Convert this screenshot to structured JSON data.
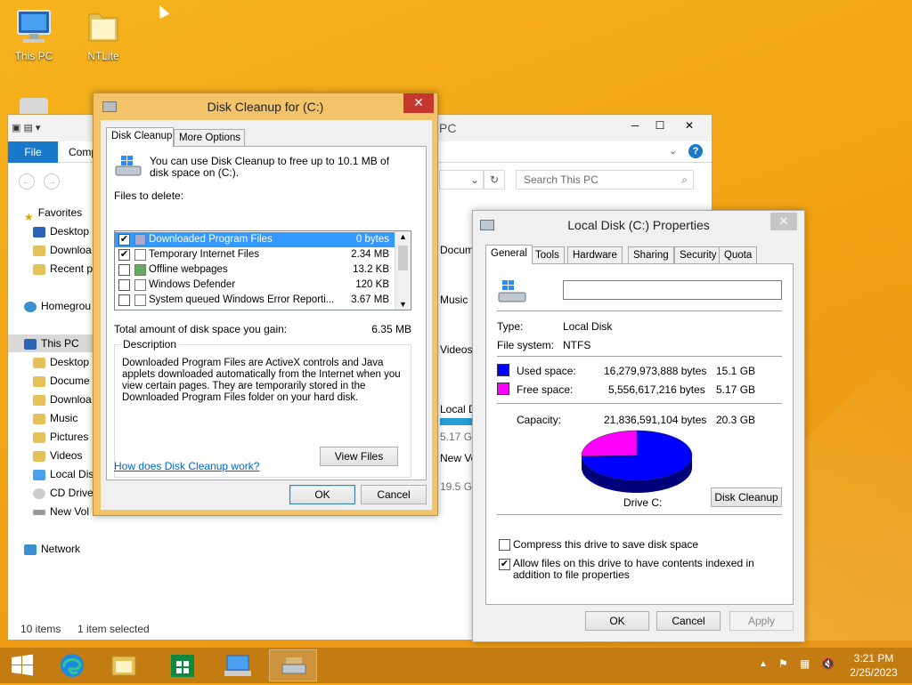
{
  "desktop": {
    "icons": [
      {
        "label": "This PC",
        "icon": "computer-icon"
      },
      {
        "label": "NTLite",
        "icon": "folder-icon"
      }
    ]
  },
  "explorer": {
    "title_fragment": "PC",
    "ribbon": {
      "file_tab": "File",
      "computer_tab": "Comp"
    },
    "search_placeholder": "Search This PC",
    "nav": {
      "favorites": "Favorites",
      "desktop": "Desktop",
      "downloads": "Downloa",
      "recent": "Recent p",
      "homegroup": "Homegrou",
      "this_pc": "This PC",
      "pc_desktop": "Desktop",
      "documents": "Docume",
      "pc_downloads": "Downloa",
      "music": "Music",
      "pictures": "Pictures",
      "videos": "Videos",
      "local_disk": "Local Dis",
      "cd_drive": "CD Drive",
      "new_volume": "New Vol",
      "network": "Network"
    },
    "content": {
      "documents": "Docum",
      "music": "Music",
      "videos": "Videos",
      "local_d": "Local D",
      "local_free": "5.17 G",
      "new_vol": "New Vo",
      "new_vol_free": "19.5 G"
    },
    "status": {
      "items": "10 items",
      "selected": "1 item selected"
    }
  },
  "disk_cleanup": {
    "title": "Disk Cleanup for  (C:)",
    "tabs": [
      "Disk Cleanup",
      "More Options"
    ],
    "intro": "You can use Disk Cleanup to free up to 10.1 MB of disk space on  (C:).",
    "files_to_delete_label": "Files to delete:",
    "files": [
      {
        "name": "Downloaded Program Files",
        "size": "0 bytes",
        "checked": "✔"
      },
      {
        "name": "Temporary Internet Files",
        "size": "2.34 MB",
        "checked": "✔"
      },
      {
        "name": "Offline webpages",
        "size": "13.2 KB",
        "checked": ""
      },
      {
        "name": "Windows Defender",
        "size": "120 KB",
        "checked": ""
      },
      {
        "name": "System queued Windows Error Reporti...",
        "size": "3.67 MB",
        "checked": ""
      }
    ],
    "total_label": "Total amount of disk space you gain:",
    "total_value": "6.35 MB",
    "description_legend": "Description",
    "description_text": "Downloaded Program Files are ActiveX controls and Java applets downloaded automatically from the Internet when you view certain pages. They are temporarily stored in the Downloaded Program Files folder on your hard disk.",
    "view_files": "View Files",
    "help_link": "How does Disk Cleanup work?",
    "ok": "OK",
    "cancel": "Cancel"
  },
  "properties": {
    "title": "Local Disk (C:) Properties",
    "tabs": [
      "General",
      "Tools",
      "Hardware",
      "Sharing",
      "Security",
      "Quota"
    ],
    "volume_label_value": "",
    "type_label": "Type:",
    "type_value": "Local Disk",
    "fs_label": "File system:",
    "fs_value": "NTFS",
    "used_label": "Used space:",
    "used_bytes": "16,279,973,888 bytes",
    "used_gb": "15.1 GB",
    "free_label": "Free space:",
    "free_bytes": "5,556,617,216 bytes",
    "free_gb": "5.17 GB",
    "capacity_label": "Capacity:",
    "capacity_bytes": "21,836,591,104 bytes",
    "capacity_gb": "20.3 GB",
    "drive_label": "Drive C:",
    "disk_cleanup_btn": "Disk Cleanup",
    "compress_label": "Compress this drive to save disk space",
    "index_label": "Allow files on this drive to have contents indexed in addition to file properties",
    "compress_checked": "",
    "index_checked": "✔",
    "ok": "OK",
    "cancel": "Cancel",
    "apply": "Apply",
    "used_fraction": 0.7455,
    "colors": {
      "used": "#0000ff",
      "free": "#ff00ff"
    }
  },
  "taskbar": {
    "clock_time": "3:21 PM",
    "clock_date": "2/25/2023"
  }
}
